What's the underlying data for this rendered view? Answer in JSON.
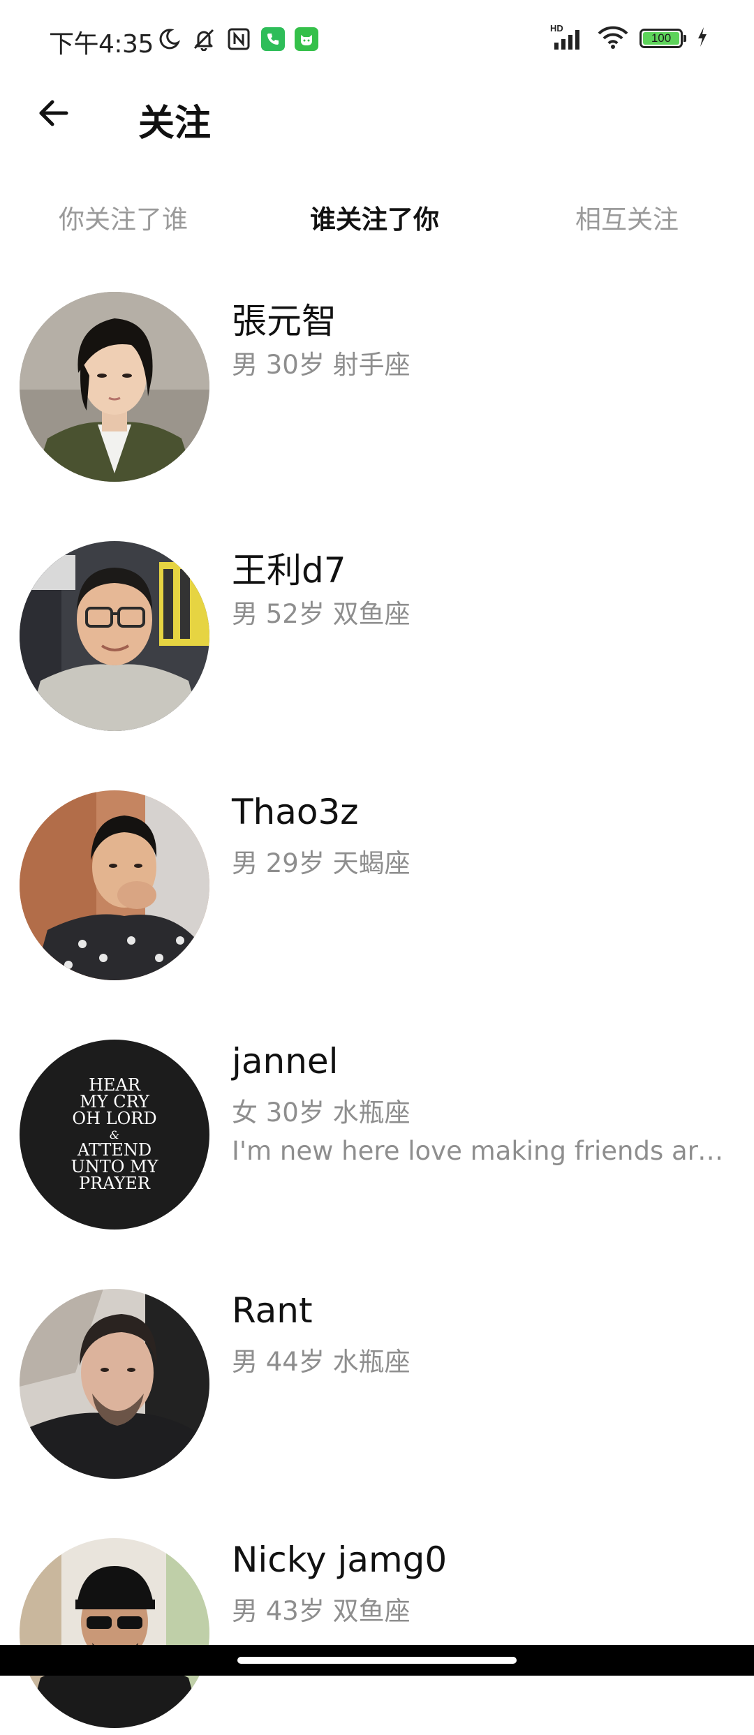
{
  "status_bar": {
    "time": "下午4:35",
    "left_icons": [
      "moon-icon",
      "bell-off-icon",
      "nfc-icon",
      "phone-app-icon",
      "cat-app-icon"
    ],
    "right_icons": [
      "hd-signal-icon",
      "wifi-icon",
      "battery-icon",
      "charging-icon"
    ],
    "network_label": "HD",
    "battery_level": "100",
    "colors": {
      "phone_app": "#2ebd59",
      "cat_app": "#35c04a",
      "battery_fill": "#5dd35a"
    }
  },
  "header": {
    "back_icon": "arrow-left-icon",
    "title": "关注"
  },
  "tabs": [
    {
      "label": "你关注了谁",
      "active": false
    },
    {
      "label": "谁关注了你",
      "active": true
    },
    {
      "label": "相互关注",
      "active": false
    }
  ],
  "users": [
    {
      "name": "張元智",
      "meta": "男 30岁 射手座",
      "bio": ""
    },
    {
      "name": "王利d7",
      "meta": "男 52岁 双鱼座",
      "bio": ""
    },
    {
      "name": "Thao3z",
      "meta": "男 29岁 天蝎座",
      "bio": ""
    },
    {
      "name": "jannel",
      "meta": "女 30岁 水瓶座",
      "bio": "I'm new here love making friends arou...",
      "avatar_text": [
        "HEAR",
        "MY CRY",
        "OH LORD",
        "&",
        "ATTEND",
        "UNTO MY",
        "PRAYER"
      ]
    },
    {
      "name": "Rant",
      "meta": "男 44岁 水瓶座",
      "bio": ""
    },
    {
      "name": "Nicky jamg0",
      "meta": "男 43岁 双鱼座",
      "bio": ""
    }
  ],
  "colors": {
    "active_tab": "#111111",
    "inactive_tab": "#9a9a9a",
    "meta_text": "#8e8e8e"
  }
}
